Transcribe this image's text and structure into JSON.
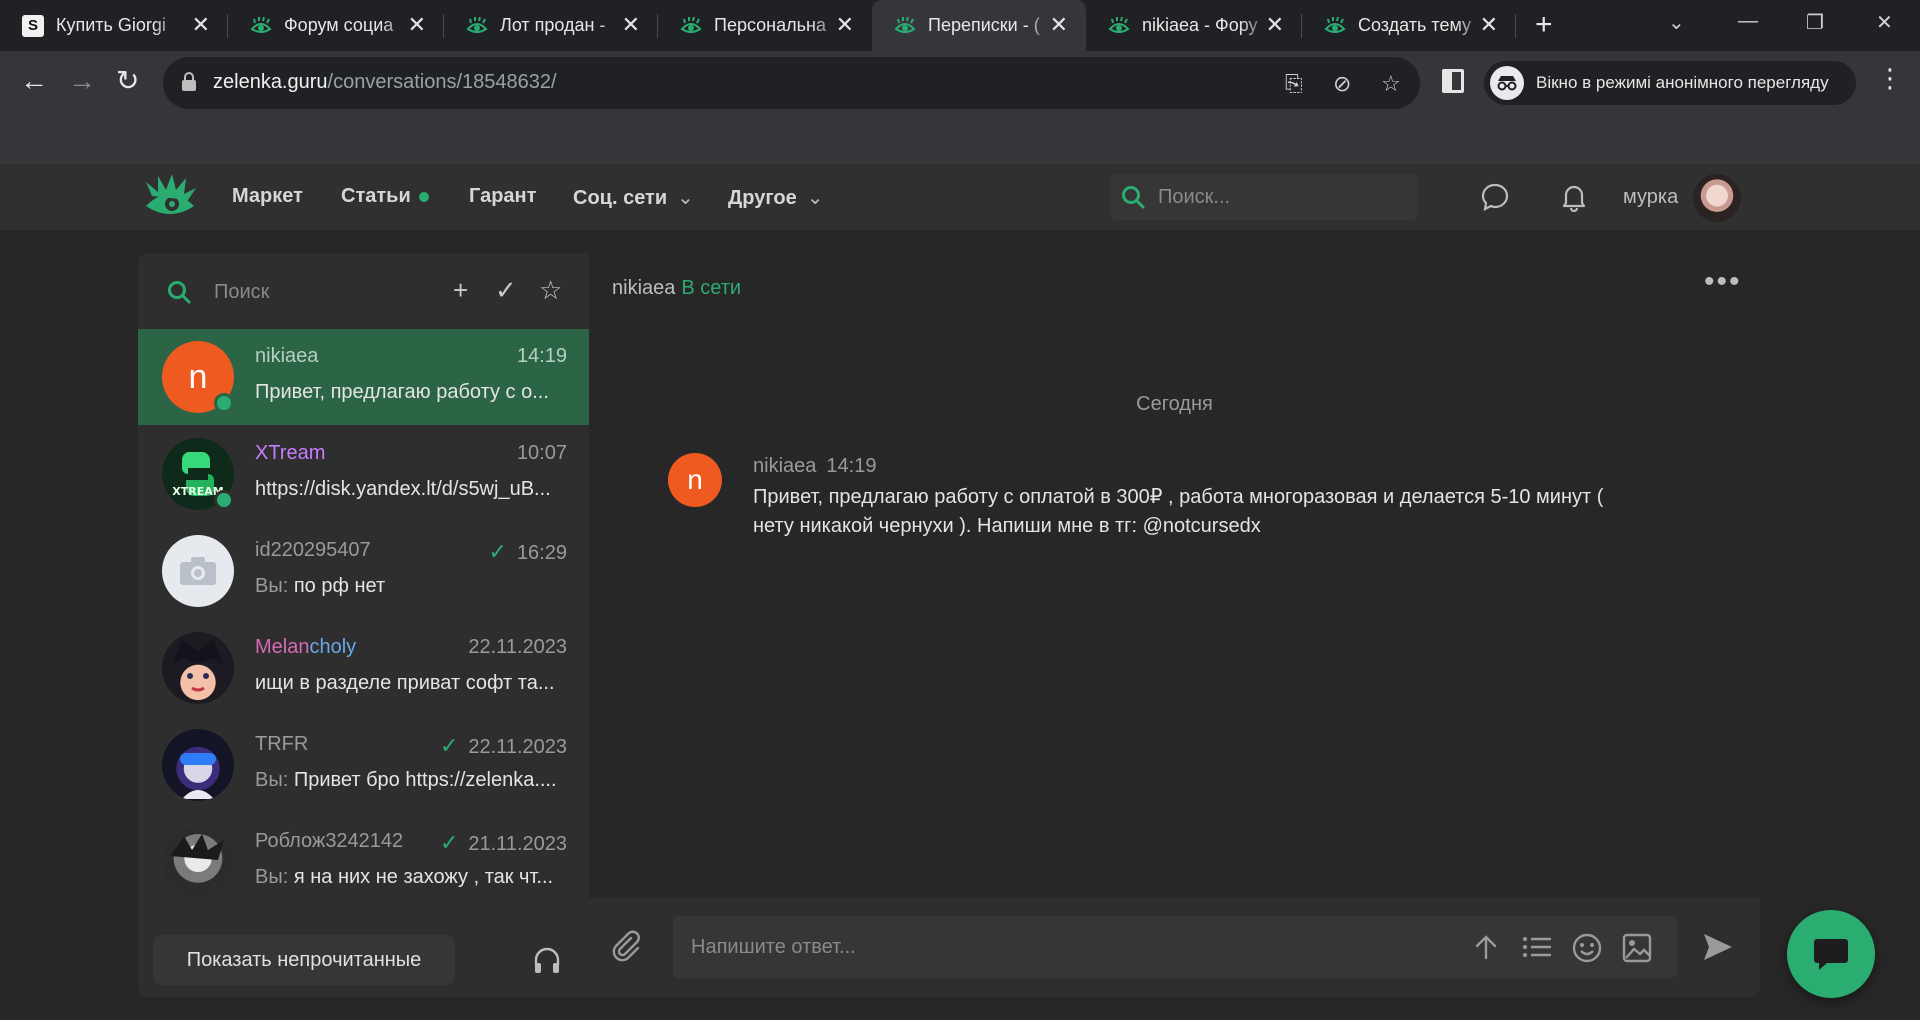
{
  "browser": {
    "tabs": [
      {
        "title": "Купить Giorgi",
        "icon": "s-favicon"
      },
      {
        "title": "Форум социа",
        "icon": "eye-favicon"
      },
      {
        "title": "Лот продан -",
        "icon": "eye-favicon"
      },
      {
        "title": "Персональна",
        "icon": "eye-favicon"
      },
      {
        "title": "Переписки - (",
        "icon": "eye-favicon",
        "active": true
      },
      {
        "title": "nikiaea - Фору",
        "icon": "eye-favicon"
      },
      {
        "title": "Создать тему",
        "icon": "eye-favicon"
      }
    ],
    "url_host": "zelenka.guru",
    "url_path": "/conversations/18548632/",
    "incognito_label": "Вікно в режимі анонімного перегляду"
  },
  "site": {
    "nav": [
      {
        "label": "Маркет"
      },
      {
        "label": "Статьи",
        "dot": true
      },
      {
        "label": "Гарант"
      },
      {
        "label": "Соц. сети",
        "dropdown": true
      },
      {
        "label": "Другое",
        "dropdown": true
      }
    ],
    "search_placeholder": "Поиск...",
    "username": "мурка",
    "accent": "#2bad72"
  },
  "conversations": {
    "search_placeholder": "Поиск",
    "items": [
      {
        "name": "nikiaea",
        "time": "14:19",
        "preview": "Привет, предлагаю работу с о...",
        "avatar_letter": "n",
        "avatar_color": "#ef5a21",
        "online": true,
        "active": true
      },
      {
        "name": "XTream",
        "time": "10:07",
        "preview": "https://disk.yandex.lt/d/s5wj_uB...",
        "name_color": "#c77dff",
        "online": true
      },
      {
        "name": "id220295407",
        "time": "16:29",
        "preview": "по рф нет",
        "you": "Вы:",
        "read": true
      },
      {
        "name_a": "Melan",
        "name_b": "choly",
        "time": "22.11.2023",
        "preview": "ищи в разделе приват софт та..."
      },
      {
        "name": "TRFR",
        "time": "22.11.2023",
        "preview": "Привет бро https://zelenka....",
        "you": "Вы:",
        "read": true
      },
      {
        "name": "Роблож3242142",
        "time": "21.11.2023",
        "preview": "я на них не захожу , так чт...",
        "you": "Вы:",
        "read": true
      }
    ],
    "show_unread_label": "Показать непрочитанные"
  },
  "chat": {
    "partner": "nikiaea",
    "status": "В сети",
    "day_label": "Сегодня",
    "message": {
      "author": "nikiaea",
      "time": "14:19",
      "avatar_letter": "n",
      "text": "Привет, предлагаю работу с оплатой в 300₽ , работа многоразовая и делается 5-10 минут ( нету никакой чернухи ). Напиши мне в тг: @notcursedx"
    },
    "reply_placeholder": "Напишите ответ..."
  }
}
